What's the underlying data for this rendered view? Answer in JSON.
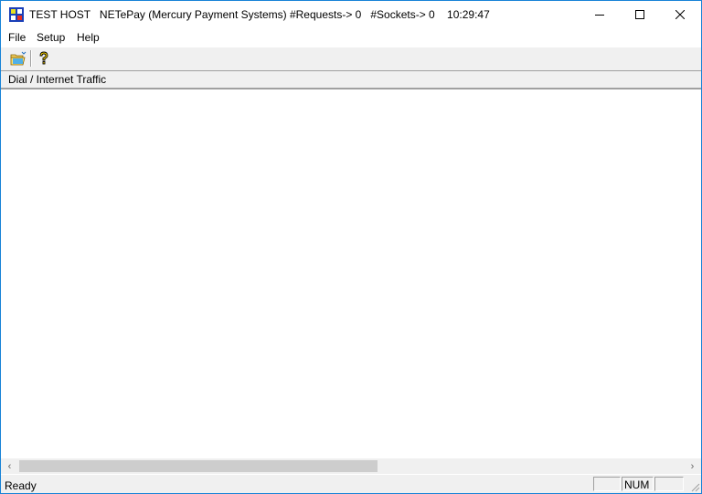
{
  "window": {
    "title": "TEST HOST   NETePay (Mercury Payment Systems) #Requests-> 0   #Sockets-> 0    10:29:47"
  },
  "menu": {
    "items": [
      {
        "label": "File"
      },
      {
        "label": "Setup"
      },
      {
        "label": "Help"
      }
    ]
  },
  "toolbar": {
    "buttons": [
      {
        "icon": "open-folder-icon"
      },
      {
        "icon": "help-icon"
      }
    ]
  },
  "panel": {
    "header": "Dial / Internet Traffic"
  },
  "scrollbar": {
    "left_arrow": "‹",
    "right_arrow": "›"
  },
  "status": {
    "text": "Ready",
    "panes": [
      "",
      "NUM",
      ""
    ]
  },
  "colors": {
    "border": "#1883d7",
    "chrome": "#f0f0f0",
    "thumb": "#cdcdcd"
  }
}
